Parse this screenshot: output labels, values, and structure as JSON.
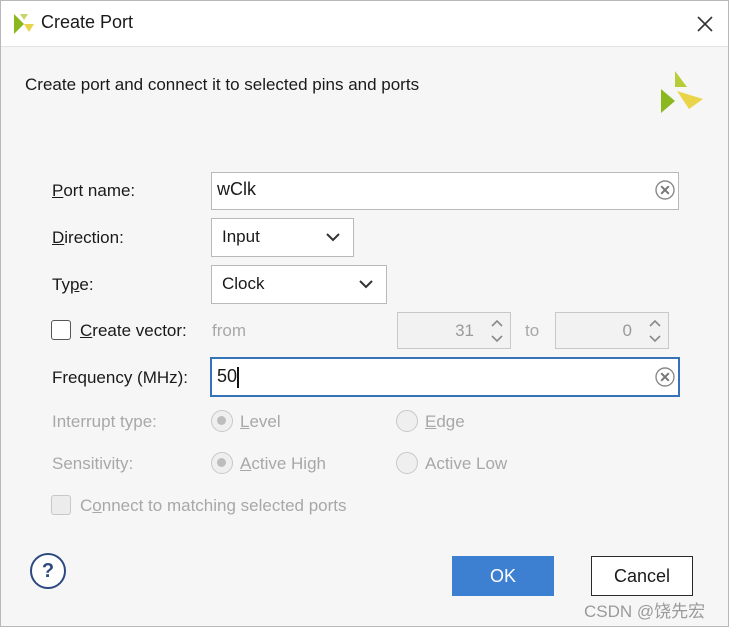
{
  "window": {
    "title": "Create Port",
    "header_text": "Create port and connect it to selected pins and ports"
  },
  "form": {
    "port_name": {
      "label_mnemonic": "P",
      "label_rest": "ort name:",
      "value": "wClk"
    },
    "direction": {
      "label_mnemonic": "D",
      "label_rest": "irection:",
      "value": "Input"
    },
    "type": {
      "label_pre": "Ty",
      "label_mnemonic": "p",
      "label_rest": "e:",
      "value": "Clock"
    },
    "create_vector": {
      "label_mnemonic": "C",
      "label_rest": "reate vector:",
      "checked": false,
      "from_label": "from",
      "from_value": "31",
      "to_label": "to",
      "to_value": "0"
    },
    "frequency": {
      "label": "Frequency (MHz):",
      "value": "50"
    },
    "interrupt_type": {
      "label": "Interrupt type:",
      "option1_mnemonic": "L",
      "option1_rest": "evel",
      "option2_mnemonic": "E",
      "option2_rest": "dge",
      "selected": "Level"
    },
    "sensitivity": {
      "label": "Sensitivity:",
      "option1_mnemonic": "A",
      "option1_rest": "ctive High",
      "option2": "Active Low",
      "selected": "Active High"
    },
    "connect_matching": {
      "label_pre": "C",
      "label_mnemonic": "o",
      "label_rest": "nnect to matching selected ports",
      "checked": false
    }
  },
  "buttons": {
    "help": "?",
    "ok": "OK",
    "cancel": "Cancel"
  },
  "watermark": "CSDN @饶先宏",
  "colors": {
    "accent": "#3d7fd0",
    "logo_green": "#8cb81f",
    "logo_yellow": "#e9d44a",
    "disabled_text": "#a8a8a8"
  }
}
